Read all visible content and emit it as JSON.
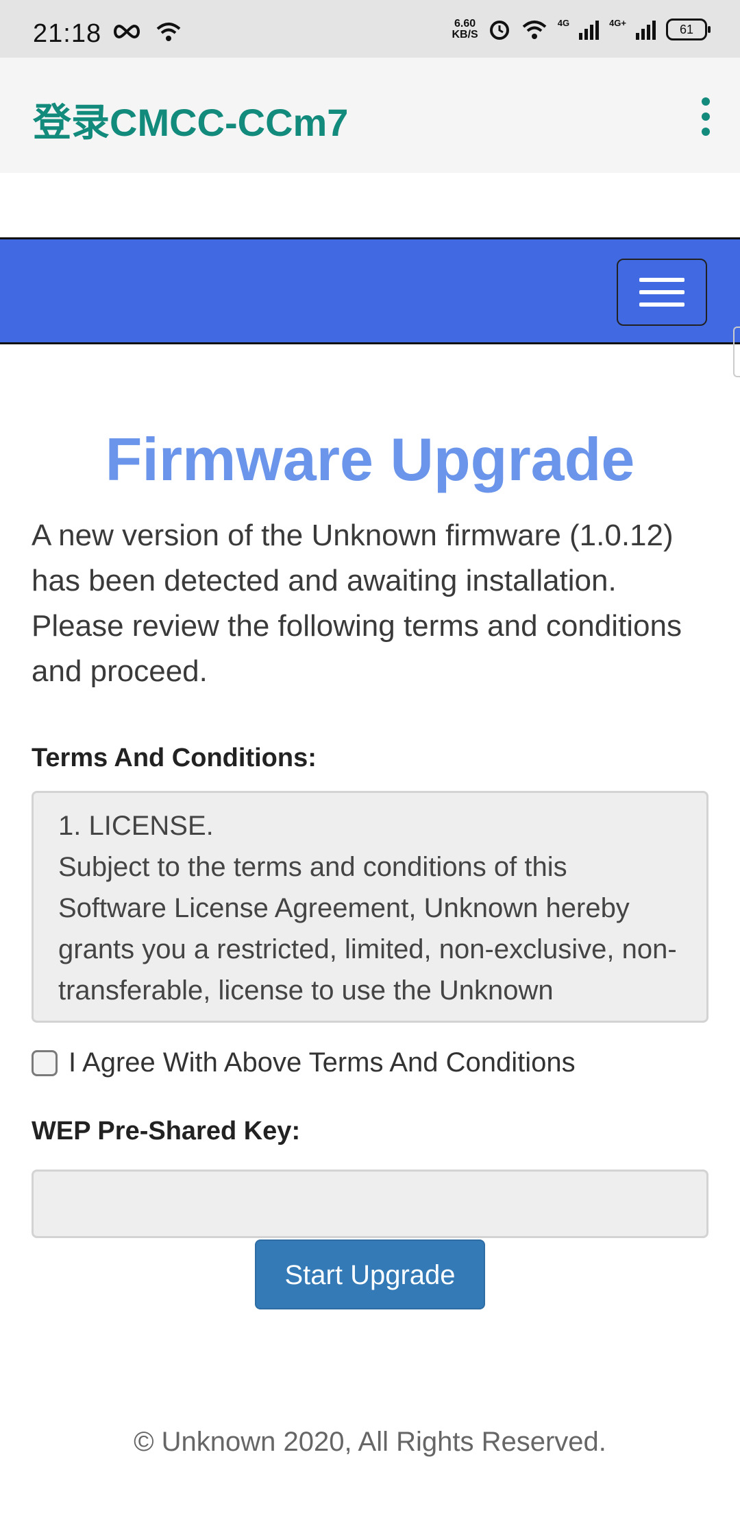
{
  "status_bar": {
    "time": "21:18",
    "speed_value": "6.60",
    "speed_unit": "KB/S",
    "net1": "4G",
    "net2": "4G+",
    "battery": "61"
  },
  "app_bar": {
    "title": "登录CMCC-CCm7"
  },
  "colors": {
    "app_accent": "#128a7c",
    "nav_blue": "#4169e1",
    "title_blue": "#6b95ea",
    "button_blue": "#337ab7"
  },
  "page": {
    "title": "Firmware Upgrade",
    "intro": "A new version of the Unknown firmware (1.0.12) has been detected and awaiting installation. Please review the following terms and conditions and proceed.",
    "terms_label": "Terms And Conditions:",
    "terms_heading": "1. LICENSE.",
    "terms_body": "Subject to the terms and conditions of this Software License Agreement, Unknown hereby grants you a restricted, limited, non-exclusive, non-transferable, license to use the Unknown Firmware/Software/Drivers solely in conjunction with",
    "agree_label": "I Agree With Above Terms And Conditions",
    "key_label": "WEP Pre-Shared Key:",
    "key_value": "",
    "start_button": "Start Upgrade",
    "footer": "© Unknown 2020, All Rights Reserved."
  }
}
